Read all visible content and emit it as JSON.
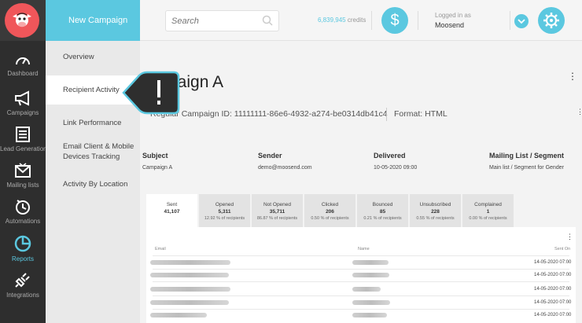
{
  "sidebar": {
    "items": [
      {
        "label": "Dashboard",
        "icon": "gauge-icon"
      },
      {
        "label": "Campaigns",
        "icon": "megaphone-icon"
      },
      {
        "label": "Lead Generation",
        "icon": "form-icon"
      },
      {
        "label": "Mailing lists",
        "icon": "envelope-icon"
      },
      {
        "label": "Automations",
        "icon": "clock-icon"
      },
      {
        "label": "Reports",
        "icon": "pie-chart-icon"
      },
      {
        "label": "Integrations",
        "icon": "plug-icon"
      }
    ],
    "active": "Reports"
  },
  "submenu": {
    "header": "New Campaign",
    "items": [
      {
        "label": "Overview"
      },
      {
        "label": "Recipient Activity"
      },
      {
        "label": "Link Performance"
      },
      {
        "label": "Email Client & Mobile Devices Tracking"
      },
      {
        "label": "Activity By Location"
      }
    ]
  },
  "topbar": {
    "search_placeholder": "Search",
    "credits_value": "6,839,945",
    "credits_label": "credits",
    "logged_in_label": "Logged in as",
    "username": "Moosend"
  },
  "main": {
    "title": "paign A",
    "campaign_id": "Regular Campaign ID: 11111111-86e6-4932-a274-be0314db41c4",
    "format": "Format: HTML",
    "details": [
      {
        "heading": "Subject",
        "value": "Campaign A"
      },
      {
        "heading": "Sender",
        "value": "demo@moosend.com"
      },
      {
        "heading": "Delivered",
        "value": "10-05-2020 09:00"
      },
      {
        "heading": "Mailing List / Segment",
        "value": "Main list / Segment for Gender"
      }
    ],
    "stats": [
      {
        "label": "Sent",
        "value": "41,107",
        "pct": ""
      },
      {
        "label": "Opened",
        "value": "5,311",
        "pct": "12.92 % of recipients"
      },
      {
        "label": "Not Opened",
        "value": "35,711",
        "pct": "86.87 % of recipients"
      },
      {
        "label": "Clicked",
        "value": "206",
        "pct": "0.50 % of recipients"
      },
      {
        "label": "Bounced",
        "value": "85",
        "pct": "0.21 % of recipients"
      },
      {
        "label": "Unsubscribed",
        "value": "228",
        "pct": "0.55 % of recipients"
      },
      {
        "label": "Complained",
        "value": "1",
        "pct": "0.00 % of recipients"
      }
    ],
    "table": {
      "headers": [
        "Email",
        "Name",
        "Sent On"
      ],
      "dates": [
        "14-05-2020 07:00",
        "14-05-2020 07:00",
        "14-05-2020 07:00",
        "14-05-2020 07:00",
        "14-05-2020 07:00"
      ]
    }
  },
  "colors": {
    "accent": "#5bc8e0",
    "brand": "#f0565a",
    "rail": "#2e2e2e"
  }
}
